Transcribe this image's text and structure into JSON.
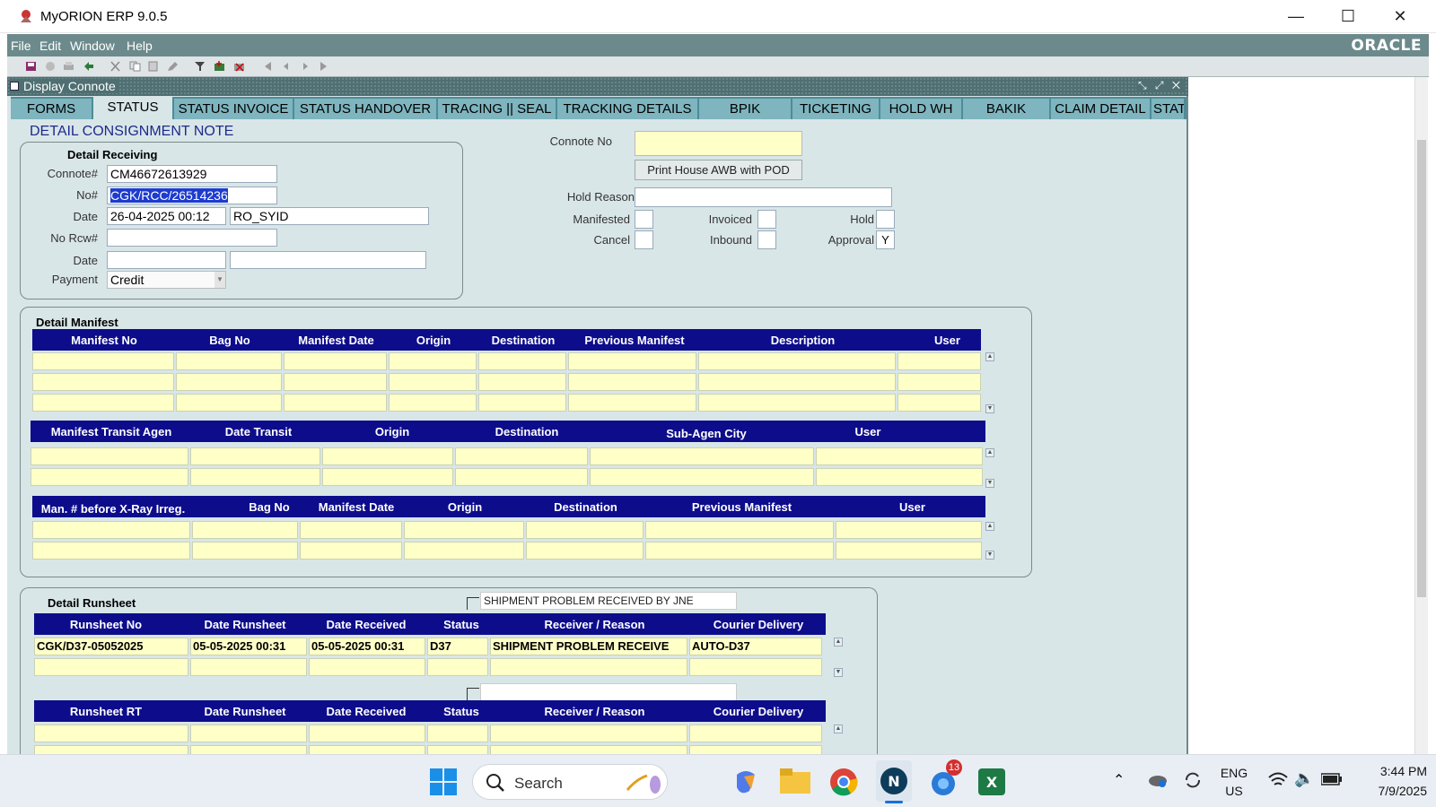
{
  "window": {
    "title": "MyORION ERP 9.0.5",
    "minimize": "—",
    "maximize": "☐",
    "close": "✕"
  },
  "menu": {
    "items": [
      "File",
      "Edit",
      "Window",
      "Help"
    ],
    "brand": "ORACLE"
  },
  "form": {
    "title": "Display Connote",
    "controls": "⤡ ⤢ ✕",
    "tabs": [
      "FORMS",
      "STATUS",
      "STATUS INVOICE",
      "STATUS HANDOVER",
      "TRACING || SEAL",
      "TRACKING DETAILS",
      "BPIK",
      "TICKETING",
      "HOLD WH",
      "BAKIK",
      "CLAIM DETAIL",
      "STATU"
    ],
    "active_tab": "STATUS",
    "heading": "DETAIL CONSIGNMENT NOTE"
  },
  "receiving": {
    "group_label": "Detail Receiving",
    "connote_label": "Connote#",
    "connote_value": "CM46672613929",
    "no_label": "No#",
    "no_value": "CGK/RCC/26514236",
    "date_label": "Date",
    "date_value": "26-04-2025 00:12",
    "user_value": "RO_SYID",
    "norcw_label": "No Rcw#",
    "norcw_value": "",
    "date2_label": "Date",
    "payment_label": "Payment",
    "payment_value": "Credit"
  },
  "connote_panel": {
    "connote_no_label": "Connote No",
    "connote_no_value": "",
    "print_button": "Print House AWB with POD",
    "hold_reason_label": "Hold Reason",
    "hold_reason_value": "",
    "manifested_label": "Manifested",
    "invoiced_label": "Invoiced",
    "hold_label": "Hold",
    "cancel_label": "Cancel",
    "inbound_label": "Inbound",
    "approval_label": "Approval",
    "approval_value": "Y"
  },
  "manifest": {
    "group_label": "Detail Manifest",
    "table1_headers": [
      "Manifest No",
      "Bag No",
      "Manifest Date",
      "Origin",
      "Destination",
      "Previous Manifest",
      "Description",
      "User"
    ],
    "table2_headers": [
      "Manifest Transit Agen",
      "Date Transit",
      "Origin",
      "Destination",
      "Sub-Agen City",
      "User"
    ],
    "table3_headers": [
      "Man. # before X-Ray Irreg.",
      "Bag No",
      "Manifest Date",
      "Origin",
      "Destination",
      "Previous Manifest",
      "User"
    ]
  },
  "runsheet": {
    "group_label": "Detail Runsheet",
    "prompt_text": "SHIPMENT PROBLEM RECEIVED BY JNE",
    "prompt2_text": "",
    "table1_headers": [
      "Runsheet No",
      "Date Runsheet",
      "Date Received",
      "Status",
      "Receiver / Reason",
      "Courier Delivery"
    ],
    "table1_rows": [
      [
        "CGK/D37-05052025",
        "05-05-2025 00:31",
        "05-05-2025 00:31",
        "D37",
        "SHIPMENT PROBLEM RECEIVE",
        "AUTO-D37"
      ],
      [
        "",
        "",
        "",
        "",
        "",
        ""
      ]
    ],
    "table2_headers": [
      "Runsheet RT",
      "Date Runsheet",
      "Date Received",
      "Status",
      "Receiver / Reason",
      "Courier Delivery"
    ]
  },
  "taskbar": {
    "search_label": "Search",
    "lang_top": "ENG",
    "lang_bottom": "US",
    "time": "3:44 PM",
    "date": "7/9/2025",
    "outlook_badge": "13",
    "colors": {
      "accent": "#0d0d8c",
      "field": "#ffffc8",
      "tab": "#7eb5bf",
      "menubar": "#6c8a8c"
    }
  }
}
